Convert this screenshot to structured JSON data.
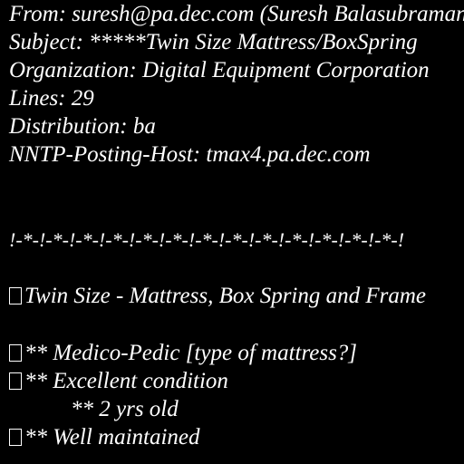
{
  "header": {
    "from": "From: suresh@pa.dec.com (Suresh Balasubramanian)",
    "subject": "Subject: *****Twin Size Mattress/BoxSpring",
    "organization": "Organization: Digital Equipment Corporation",
    "lines": "Lines: 29",
    "distribution": "Distribution: ba",
    "nntp_host": "NNTP-Posting-Host: tmax4.pa.dec.com"
  },
  "body": {
    "separator": "!-*-!-*-!-*-!-*-!-*-!-*-!-*-!-*-!-*-!-*-!-*-!-*-!-*-!",
    "title": "Twin Size - Mattress, Box Spring and Frame",
    "items": [
      {
        "text": "** Medico-Pedic [type of mattress?]",
        "bullet": true
      },
      {
        "text": "** Excellent condition",
        "bullet": true
      },
      {
        "text": "** 2 yrs old",
        "bullet": false
      },
      {
        "text": "** Well maintained",
        "bullet": true
      }
    ]
  },
  "colors": {
    "background": "#000000",
    "text": "#ffffff"
  }
}
